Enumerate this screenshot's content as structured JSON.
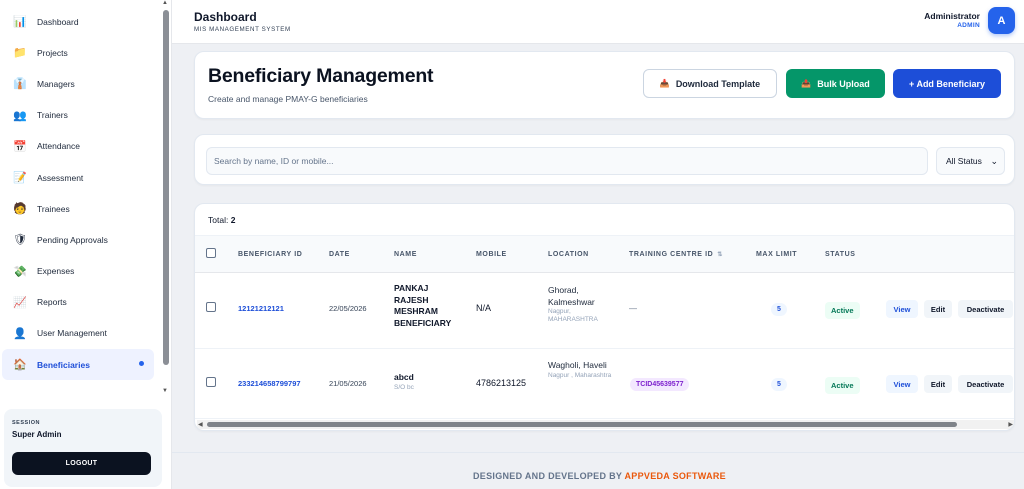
{
  "sidebar": {
    "items": [
      {
        "label": "Dashboard",
        "icon": "📊"
      },
      {
        "label": "Projects",
        "icon": "📁"
      },
      {
        "label": "Managers",
        "icon": "👔"
      },
      {
        "label": "Trainers",
        "icon": "👥"
      },
      {
        "label": "Attendance",
        "icon": "📅"
      },
      {
        "label": "Assessment",
        "icon": "📝"
      },
      {
        "label": "Trainees",
        "icon": "🧑"
      },
      {
        "label": "Pending Approvals",
        "icon": "🛡"
      },
      {
        "label": "Expenses",
        "icon": "💸"
      },
      {
        "label": "Reports",
        "icon": "📈"
      },
      {
        "label": "User Management",
        "icon": "👤"
      },
      {
        "label": "Beneficiaries",
        "icon": "🏠"
      }
    ],
    "active_index": 11,
    "session": {
      "label": "SESSION",
      "name": "Super Admin",
      "logout": "LOGOUT"
    }
  },
  "header": {
    "title": "Dashboard",
    "subtitle": "MIS MANAGEMENT SYSTEM",
    "user_name": "Administrator",
    "user_role": "ADMIN",
    "avatar": "A"
  },
  "page": {
    "title": "Beneficiary Management",
    "subtitle": "Create and manage PMAY-G beneficiaries",
    "buttons": {
      "download": "Download Template",
      "bulk": "Bulk Upload",
      "add": "+ Add Beneficiary"
    }
  },
  "search": {
    "placeholder": "Search by name, ID or mobile...",
    "status_filter": "All Status"
  },
  "table": {
    "total_label": "Total:",
    "total": "2",
    "columns": [
      "BENEFICIARY ID",
      "DATE",
      "NAME",
      "MOBILE",
      "LOCATION",
      "TRAINING CENTRE ID",
      "MAX LIMIT",
      "STATUS"
    ],
    "rows": [
      {
        "id": "12121212121",
        "date": "22/05/2026",
        "name": "PANKAJ RAJESH MESHRAM BENEFICIARY",
        "name_sub": "",
        "mobile": "N/A",
        "location": "Ghorad, Kalmeshwar",
        "location_sub": "Nagpur, MAHARASHTRA",
        "training_centre": "—",
        "max_limit": "5",
        "status": "Active"
      },
      {
        "id": "233214658799797",
        "date": "21/05/2026",
        "name": "abcd",
        "name_sub": "S/O bc",
        "mobile": "4786213125",
        "location": "Wagholi, Haveli",
        "location_sub": "Nagpur , Maharashtra",
        "training_centre": "TCID45639577",
        "max_limit": "5",
        "status": "Active"
      }
    ],
    "actions": {
      "view": "View",
      "edit": "Edit",
      "deactivate": "Deactivate"
    }
  },
  "footer": {
    "text": "DESIGNED AND DEVELOPED BY",
    "brand": "APPVEDA SOFTWARE"
  },
  "colors": {
    "primary": "#1d4ed8",
    "success": "#059669",
    "brand": "#ea580c"
  }
}
